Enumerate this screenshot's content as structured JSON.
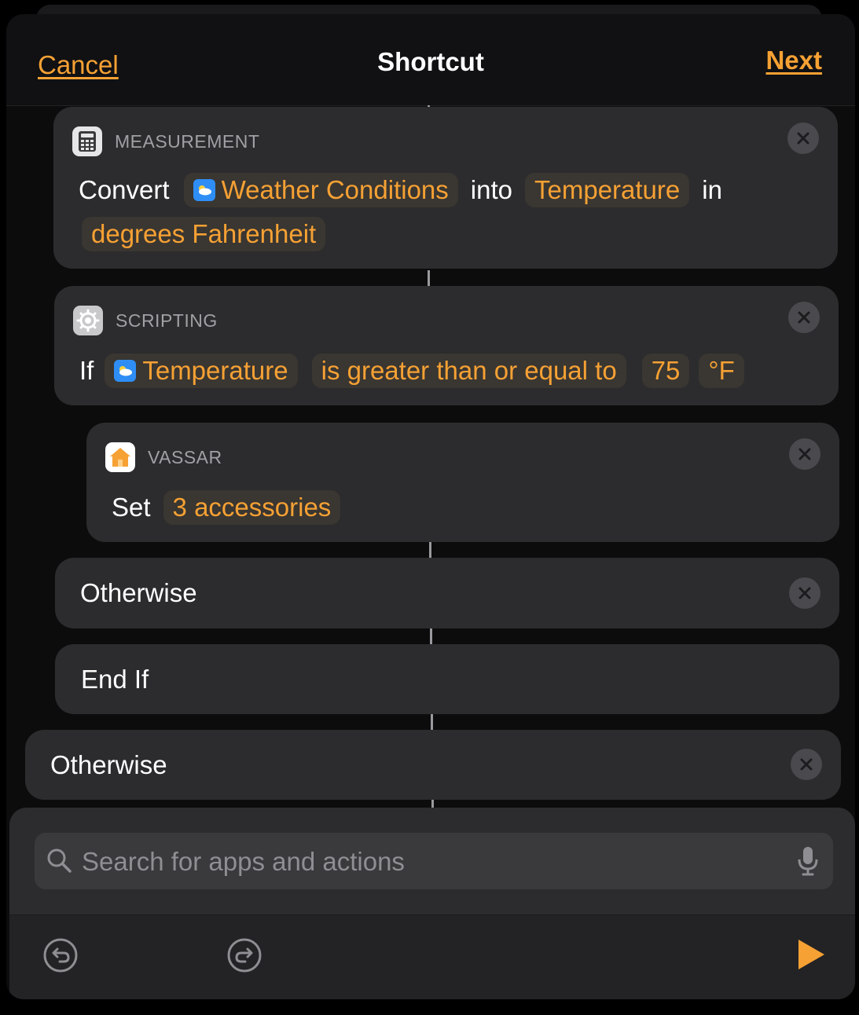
{
  "header": {
    "cancel_label": "Cancel",
    "title": "Shortcut",
    "next_label": "Next"
  },
  "actions": {
    "measurement": {
      "category": "MEASUREMENT",
      "icon": "calculator-icon",
      "verb": "Convert",
      "input_token": "Weather Conditions",
      "into_word": "into",
      "unit_type_token": "Temperature",
      "in_word": "in",
      "unit_token": "degrees Fahrenheit"
    },
    "scripting": {
      "category": "SCRIPTING",
      "icon": "gear-icon",
      "verb": "If",
      "input_token": "Temperature",
      "condition_token": "is greater than or equal to",
      "value_token": "75",
      "unit_token": "°F"
    },
    "vassar": {
      "category": "VASSAR",
      "icon": "home-icon",
      "verb": "Set",
      "target_token": "3 accessories"
    },
    "otherwise_inner": "Otherwise",
    "end_if": "End If",
    "otherwise_outer": "Otherwise"
  },
  "bottom_bar": {
    "search_placeholder": "Search for apps and actions"
  },
  "colors": {
    "accent": "#f6a134",
    "card_bg": "#2c2c2e",
    "background": "#000000"
  }
}
